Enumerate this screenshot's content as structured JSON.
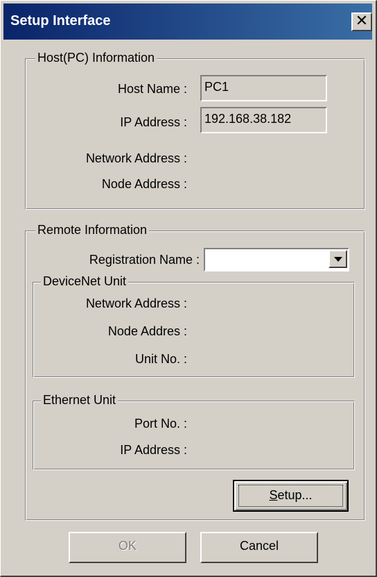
{
  "window": {
    "title": "Setup Interface",
    "close_glyph": "✕"
  },
  "host": {
    "legend": "Host(PC) Information",
    "host_name_label": "Host Name :",
    "host_name_value": "PC1",
    "ip_label": "IP Address :",
    "ip_value": "192.168.38.182",
    "network_label": "Network Address :",
    "node_label": "Node Address :"
  },
  "remote": {
    "legend": "Remote Information",
    "registration_label": "Registration Name :",
    "registration_value": "",
    "devicenet": {
      "legend": "DeviceNet Unit",
      "network_label": "Network Address :",
      "node_label": "Node Addres :",
      "unit_label": "Unit No. :"
    },
    "ethernet": {
      "legend": "Ethernet Unit",
      "port_label": "Port No. :",
      "ip_label": "IP Address :"
    },
    "setup_button": {
      "mnemonic": "S",
      "rest": "etup..."
    }
  },
  "buttons": {
    "ok": "OK",
    "cancel": "Cancel"
  }
}
